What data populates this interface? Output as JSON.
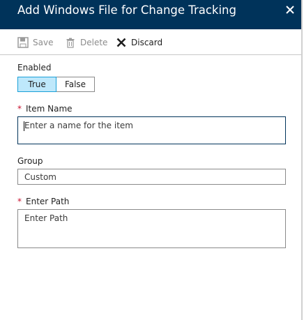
{
  "blade": {
    "title": "Add Windows File for Change Tracking"
  },
  "toolbar": {
    "save_label": "Save",
    "delete_label": "Delete",
    "discard_label": "Discard"
  },
  "enabled": {
    "label": "Enabled",
    "options": [
      "True",
      "False"
    ],
    "selected": "True"
  },
  "item_name": {
    "label": "Item Name",
    "required_marker": "*",
    "value": "",
    "placeholder": "Enter a name for the item"
  },
  "group": {
    "label": "Group",
    "value": "Custom"
  },
  "path": {
    "label": "Enter Path",
    "required_marker": "*",
    "value": "",
    "placeholder": "Enter Path"
  },
  "colors": {
    "header": "#00335a",
    "toggle_selected": "#bee8fb",
    "required": "#c8102e"
  },
  "icons": {
    "close": "close-icon",
    "save": "save-icon",
    "delete": "trash-icon",
    "discard": "x-icon"
  }
}
